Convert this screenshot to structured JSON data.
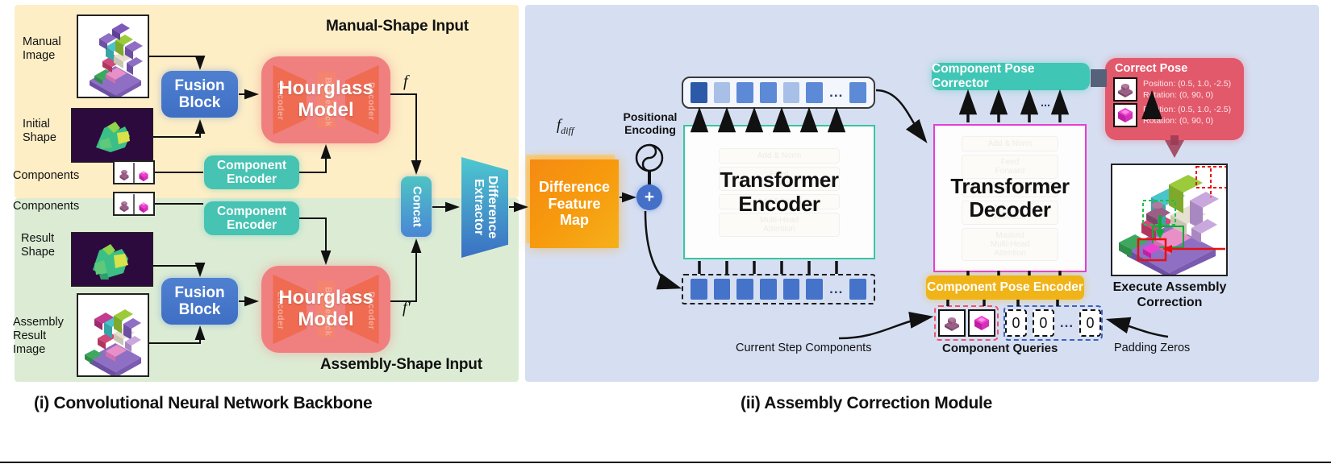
{
  "panels": {
    "manual": {
      "title": "Manual-Shape Input"
    },
    "assembly": {
      "title": "Assembly-Shape Input"
    },
    "acm": {
      "title": ""
    }
  },
  "captions": {
    "left": "(i) Convolutional Neural Network Backbone",
    "right": "(ii) Assembly Correction Module"
  },
  "backbone": {
    "manual_image_label": "Manual\nImage",
    "initial_shape_label": "Initial\nShape",
    "components_label_top": "Components",
    "components_label_bottom": "Components",
    "result_shape_label": "Result\nShape",
    "assembly_result_image_label": "Assembly\nResult\nImage",
    "fusion_block_label": "Fusion\nBlock",
    "hourglass_label": "Hourglass\nModel",
    "hourglass_sub_encoder": "Encoder",
    "hourglass_sub_bottleneck": "Bottleneck",
    "hourglass_sub_decoder": "Decoder",
    "component_encoder_label": "Component\nEncoder",
    "concat_label": "Concat",
    "f_top": "f",
    "f_bottom": "f'"
  },
  "middle": {
    "difference_extractor_label": "Difference\nExtractor",
    "difference_feature_map_label": "Difference\nFeature\nMap",
    "fdiff_label": "f",
    "fdiff_sub": "diff",
    "positional_encoding_label": "Positional\nEncoding",
    "plus_symbol": "+"
  },
  "acm": {
    "transformer_encoder_label": "Transformer\nEncoder",
    "transformer_decoder_label": "Transformer\nDecoder",
    "encoder_ghost": [
      "Add & Norm",
      "Feed\nForward",
      "Add & Norm",
      "Multi-Head\nAttention"
    ],
    "decoder_ghost": [
      "Add & Norm",
      "Feed\nForward",
      "Add & Norm",
      "Multi-Head\nAttention",
      "Masked\nMulti-Head\nAttention"
    ],
    "pose_corrector_label": "Component Pose Corrector",
    "pose_encoder_label": "Component Pose Encoder",
    "ellipsis": "...",
    "queries": {
      "title": "Component Queries",
      "current_step_label": "Current Step Components",
      "padding_zeros_label": "Padding Zeros",
      "zero_value": "0",
      "zeros": [
        "0",
        "0",
        "0"
      ],
      "ellipsis": "..."
    },
    "correct_pose": {
      "title": "Correct Pose",
      "entries": [
        {
          "position": "Position: (0.5, 1.0, -2.5)",
          "rotation": "Rotation: (0, 90, 0)"
        },
        {
          "position": "Position: (0.5, 1.0, -2.5)",
          "rotation": "Rotation: (0, 90, 0)"
        }
      ]
    },
    "execute_label": "Execute Assembly\nCorrection"
  },
  "tokens": {
    "encoder_output_colors": [
      "#2d5aa8",
      "#a8c0e8",
      "#5d8ad6",
      "#5d8ad6",
      "#a8c0e8",
      "#5d8ad6",
      "#5d8ad6"
    ],
    "encoder_input_colors": [
      "#4573c9",
      "#4573c9",
      "#4573c9",
      "#4573c9",
      "#4573c9",
      "#4573c9",
      "#4573c9"
    ]
  },
  "colors": {
    "panel_manual": "#fdeec6",
    "panel_assembly": "#dcecd4",
    "panel_acm": "#d6dff2",
    "fusion_block": "#4f80d0",
    "hourglass": "#f08080",
    "component_encoder": "#46c3b2",
    "difference_feature_map": "#f5990f",
    "pose_corrector": "#40c6b4",
    "pose_encoder": "#f0b419",
    "correct_pose_card": "#e2596b",
    "encoder_border": "#37c6a0",
    "decoder_border": "#e63ed0"
  }
}
